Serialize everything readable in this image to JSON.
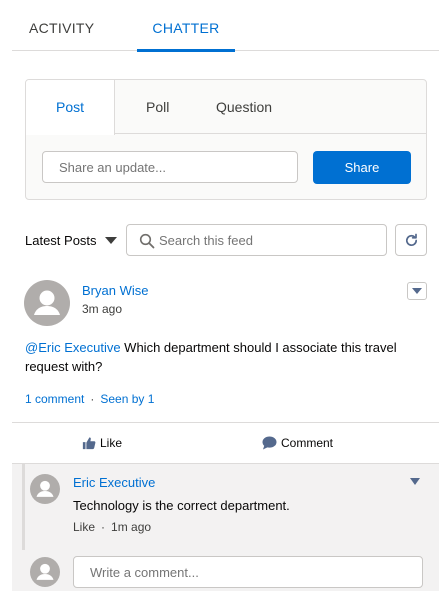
{
  "tabs": {
    "activity": "ACTIVITY",
    "chatter": "CHATTER"
  },
  "publisher": {
    "tabs": [
      "Post",
      "Poll",
      "Question"
    ],
    "share_placeholder": "Share an update...",
    "share_button": "Share"
  },
  "feed_controls": {
    "sort_label": "Latest Posts",
    "search_placeholder": "Search this feed"
  },
  "post": {
    "author": "Bryan Wise",
    "time": "3m ago",
    "mention": "@Eric Executive",
    "text": " Which department should I associate this travel request with?",
    "comments_count": "1 comment",
    "seen_by": "Seen by 1",
    "like_label": "Like",
    "comment_label": "Comment"
  },
  "comment": {
    "author": "Eric Executive",
    "text": "Technology is the correct department.",
    "like_label": "Like",
    "time": "1m ago"
  },
  "write_comment_placeholder": "Write a comment...",
  "colors": {
    "accent": "#0070d2",
    "avatar": "#b0adab",
    "border": "#dddbda"
  },
  "icons": [
    "search-icon",
    "refresh-icon",
    "like-icon",
    "comment-icon",
    "user-avatar-icon",
    "dropdown-icon"
  ]
}
